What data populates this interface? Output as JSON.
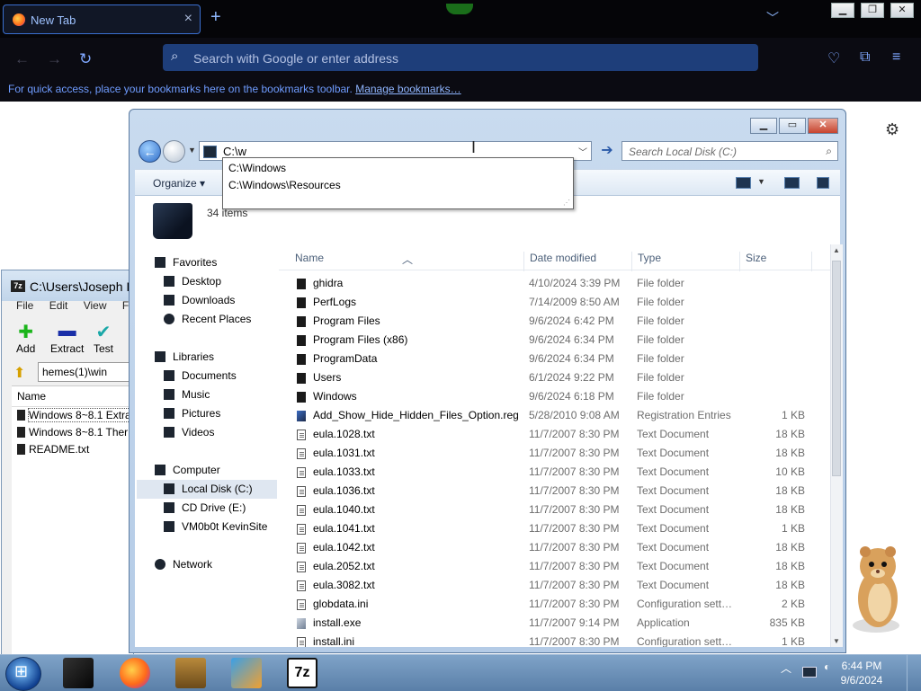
{
  "browser": {
    "tab_title": "New Tab",
    "url_placeholder": "Search with Google or enter address",
    "bookmarks_text": "For quick access, place your bookmarks here on the bookmarks toolbar.",
    "bookmarks_link": "Manage bookmarks…",
    "icons": [
      "firefox-logo-icon",
      "close-icon",
      "plus-icon",
      "chevron-down-icon",
      "back-icon",
      "forward-icon",
      "reload-icon",
      "search-icon",
      "pocket-icon",
      "extensions-icon",
      "menu-icon",
      "gear-icon"
    ]
  },
  "zip": {
    "title": "C:\\Users\\Joseph I",
    "menu": [
      "File",
      "Edit",
      "View",
      "Favo"
    ],
    "buttons": [
      "Add",
      "Extract",
      "Test"
    ],
    "address": "hemes(1)\\win",
    "column": "Name",
    "files": [
      "Windows 8~8.1 Extra",
      "Windows 8~8.1 Ther",
      "README.txt"
    ]
  },
  "explorer": {
    "address": "C:\\w",
    "search_placeholder": "Search Local Disk (C:)",
    "organize": "Organize",
    "item_count": "34 items",
    "autocomplete": [
      "C:\\Windows",
      "C:\\Windows\\Resources"
    ],
    "nav": {
      "favorites": "Favorites",
      "desktop": "Desktop",
      "downloads": "Downloads",
      "recent": "Recent Places",
      "libraries": "Libraries",
      "documents": "Documents",
      "music": "Music",
      "pictures": "Pictures",
      "videos": "Videos",
      "computer": "Computer",
      "localdisk": "Local Disk (C:)",
      "cddrive": "CD Drive (E:)",
      "kevinsite": "VM0b0t KevinSite",
      "network": "Network"
    },
    "columns": {
      "name": "Name",
      "date": "Date modified",
      "type": "Type",
      "size": "Size"
    },
    "rows": [
      {
        "name": "ghidra",
        "date": "4/10/2024 3:39 PM",
        "type": "File folder",
        "size": "",
        "icon": "folder"
      },
      {
        "name": "PerfLogs",
        "date": "7/14/2009 8:50 AM",
        "type": "File folder",
        "size": "",
        "icon": "folder"
      },
      {
        "name": "Program Files",
        "date": "9/6/2024 6:42 PM",
        "type": "File folder",
        "size": "",
        "icon": "folder"
      },
      {
        "name": "Program Files (x86)",
        "date": "9/6/2024 6:34 PM",
        "type": "File folder",
        "size": "",
        "icon": "folder"
      },
      {
        "name": "ProgramData",
        "date": "9/6/2024 6:34 PM",
        "type": "File folder",
        "size": "",
        "icon": "folder"
      },
      {
        "name": "Users",
        "date": "6/1/2024 9:22 PM",
        "type": "File folder",
        "size": "",
        "icon": "folder"
      },
      {
        "name": "Windows",
        "date": "9/6/2024 6:18 PM",
        "type": "File folder",
        "size": "",
        "icon": "folder"
      },
      {
        "name": "Add_Show_Hide_Hidden_Files_Option.reg",
        "date": "5/28/2010 9:08 AM",
        "type": "Registration Entries",
        "size": "1 KB",
        "icon": "reg"
      },
      {
        "name": "eula.1028.txt",
        "date": "11/7/2007 8:30 PM",
        "type": "Text Document",
        "size": "18 KB",
        "icon": "file"
      },
      {
        "name": "eula.1031.txt",
        "date": "11/7/2007 8:30 PM",
        "type": "Text Document",
        "size": "18 KB",
        "icon": "file"
      },
      {
        "name": "eula.1033.txt",
        "date": "11/7/2007 8:30 PM",
        "type": "Text Document",
        "size": "10 KB",
        "icon": "file"
      },
      {
        "name": "eula.1036.txt",
        "date": "11/7/2007 8:30 PM",
        "type": "Text Document",
        "size": "18 KB",
        "icon": "file"
      },
      {
        "name": "eula.1040.txt",
        "date": "11/7/2007 8:30 PM",
        "type": "Text Document",
        "size": "18 KB",
        "icon": "file"
      },
      {
        "name": "eula.1041.txt",
        "date": "11/7/2007 8:30 PM",
        "type": "Text Document",
        "size": "1 KB",
        "icon": "file"
      },
      {
        "name": "eula.1042.txt",
        "date": "11/7/2007 8:30 PM",
        "type": "Text Document",
        "size": "18 KB",
        "icon": "file"
      },
      {
        "name": "eula.2052.txt",
        "date": "11/7/2007 8:30 PM",
        "type": "Text Document",
        "size": "18 KB",
        "icon": "file"
      },
      {
        "name": "eula.3082.txt",
        "date": "11/7/2007 8:30 PM",
        "type": "Text Document",
        "size": "18 KB",
        "icon": "file"
      },
      {
        "name": "globdata.ini",
        "date": "11/7/2007 8:30 PM",
        "type": "Configuration sett…",
        "size": "2 KB",
        "icon": "file"
      },
      {
        "name": "install.exe",
        "date": "11/7/2007 9:14 PM",
        "type": "Application",
        "size": "835 KB",
        "icon": "exe"
      },
      {
        "name": "install.ini",
        "date": "11/7/2007 8:30 PM",
        "type": "Configuration sett…",
        "size": "1 KB",
        "icon": "file"
      }
    ]
  },
  "taskbar": {
    "time": "6:44 PM",
    "date": "9/6/2024",
    "apps": [
      "explorer-app-icon",
      "firefox-app-icon",
      "boxedapp-icon",
      "virtualbox-icon",
      "7zip-icon"
    ]
  },
  "colors": {
    "firefox_bg": "#0b0b12",
    "urlbar": "#1e3e7a",
    "taskbar": "#6c91ba",
    "explorer_frame": "#c9dbef"
  }
}
